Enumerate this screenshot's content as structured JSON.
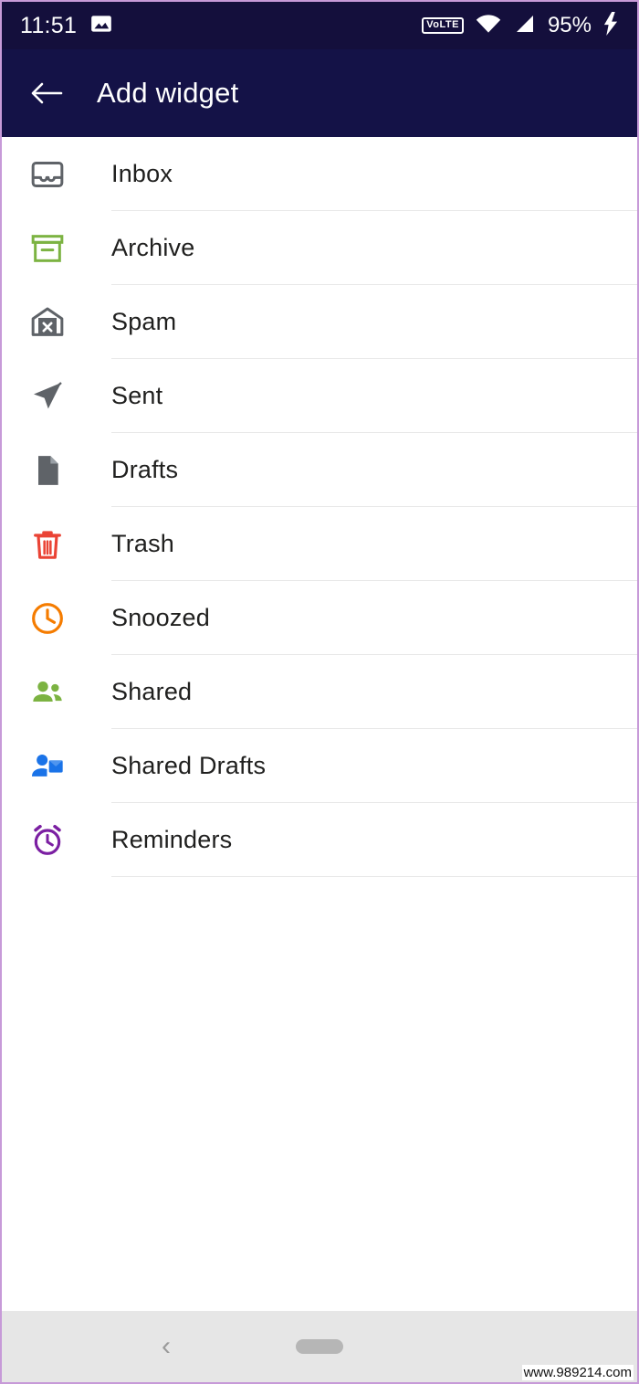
{
  "status_bar": {
    "time": "11:51",
    "gallery_icon": "image-icon",
    "volte_label": "VoLTE",
    "wifi_icon": "wifi-icon",
    "signal_icon": "cellular-signal-icon",
    "battery_percent": "95%",
    "charging_icon": "lightning-bolt-icon",
    "background_color": "#140f3c"
  },
  "app_bar": {
    "back_icon": "arrow-left-icon",
    "title": "Add widget",
    "background_color": "#141247",
    "text_color": "#ffffff"
  },
  "widget_list": [
    {
      "label": "Inbox",
      "icon": "inbox-icon",
      "color": "#5f6368"
    },
    {
      "label": "Archive",
      "icon": "archive-icon",
      "color": "#7cb342"
    },
    {
      "label": "Spam",
      "icon": "spam-icon",
      "color": "#5f6368"
    },
    {
      "label": "Sent",
      "icon": "sent-paper-plane-icon",
      "color": "#5f6368"
    },
    {
      "label": "Drafts",
      "icon": "draft-document-icon",
      "color": "#5f6368"
    },
    {
      "label": "Trash",
      "icon": "trash-icon",
      "color": "#ea4335"
    },
    {
      "label": "Snoozed",
      "icon": "clock-icon",
      "color": "#f57c00"
    },
    {
      "label": "Shared",
      "icon": "people-icon",
      "color": "#7cb342"
    },
    {
      "label": "Shared Drafts",
      "icon": "shared-drafts-icon",
      "color": "#1a73e8"
    },
    {
      "label": "Reminders",
      "icon": "alarm-clock-icon",
      "color": "#7b1fa2"
    }
  ],
  "nav_bar": {
    "back_icon": "chevron-left-icon",
    "home_pill": "home-pill-handle",
    "background_color": "#e6e6e6"
  },
  "watermark": "www.989214.com"
}
